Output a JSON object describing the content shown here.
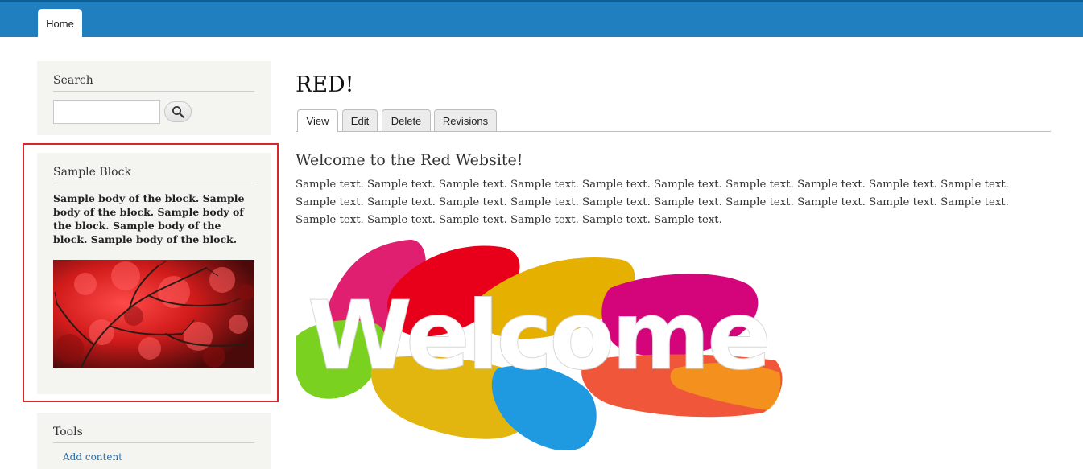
{
  "nav": {
    "home_tab": "Home"
  },
  "sidebar": {
    "search": {
      "title": "Search",
      "input_value": "",
      "button_icon": "search-icon"
    },
    "sample_block": {
      "title": "Sample Block",
      "body": "Sample body of the block. Sample body of the block. Sample body of the block. Sample body of the block. Sample body of the block."
    },
    "tools": {
      "title": "Tools",
      "links": [
        "Add content"
      ]
    }
  },
  "main": {
    "page_title": "RED!",
    "tabs": [
      {
        "label": "View",
        "active": true
      },
      {
        "label": "Edit",
        "active": false
      },
      {
        "label": "Delete",
        "active": false
      },
      {
        "label": "Revisions",
        "active": false
      }
    ],
    "heading": "Welcome to the Red Website!",
    "body": "Sample text. Sample text. Sample text. Sample text. Sample text. Sample text. Sample text. Sample text. Sample text. Sample text. Sample text. Sample text. Sample text. Sample text. Sample text. Sample text. Sample text. Sample text. Sample text. Sample text. Sample text. Sample text. Sample text. Sample text. Sample text. Sample text.",
    "image_text": "Welcome"
  },
  "colors": {
    "topbar": "#1f7fbf",
    "highlight": "#d9252b",
    "sidebar_bg": "#f4f4f0",
    "link": "#1f6fb2"
  }
}
